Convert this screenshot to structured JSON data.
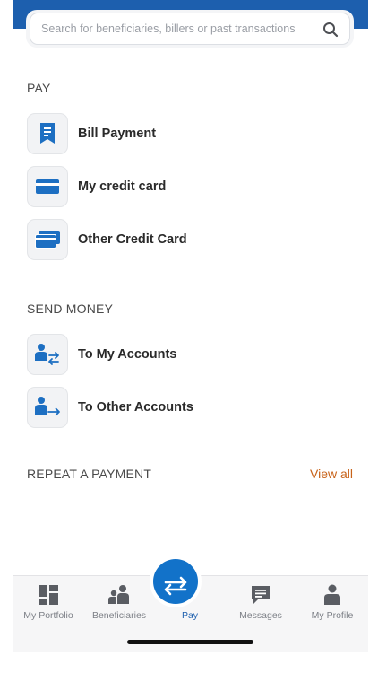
{
  "search": {
    "placeholder": "Search for beneficiaries, billers or past transactions"
  },
  "pay": {
    "title": "PAY",
    "items": [
      {
        "label": "Bill Payment",
        "icon": "receipt-icon"
      },
      {
        "label": "My credit card",
        "icon": "credit-card-icon"
      },
      {
        "label": "Other Credit Card",
        "icon": "stacked-cards-icon"
      }
    ]
  },
  "send_money": {
    "title": "SEND MONEY",
    "items": [
      {
        "label": "To My Accounts",
        "icon": "person-transfer-icon"
      },
      {
        "label": "To Other Accounts",
        "icon": "person-send-icon"
      }
    ]
  },
  "repeat_payment": {
    "title": "REPEAT A PAYMENT",
    "view_all": "View all"
  },
  "bottom_nav": {
    "items": [
      {
        "label": "My Portfolio",
        "icon": "dashboard-icon"
      },
      {
        "label": "Beneficiaries",
        "icon": "people-icon"
      },
      {
        "label": "Pay",
        "icon": "transfer-arrows-icon",
        "active": true
      },
      {
        "label": "Messages",
        "icon": "chat-icon"
      },
      {
        "label": "My Profile",
        "icon": "person-icon"
      }
    ]
  },
  "colors": {
    "brand_blue": "#1d5fae",
    "accent_orange": "#c8631a",
    "icon_blue": "#1d6fc2"
  }
}
